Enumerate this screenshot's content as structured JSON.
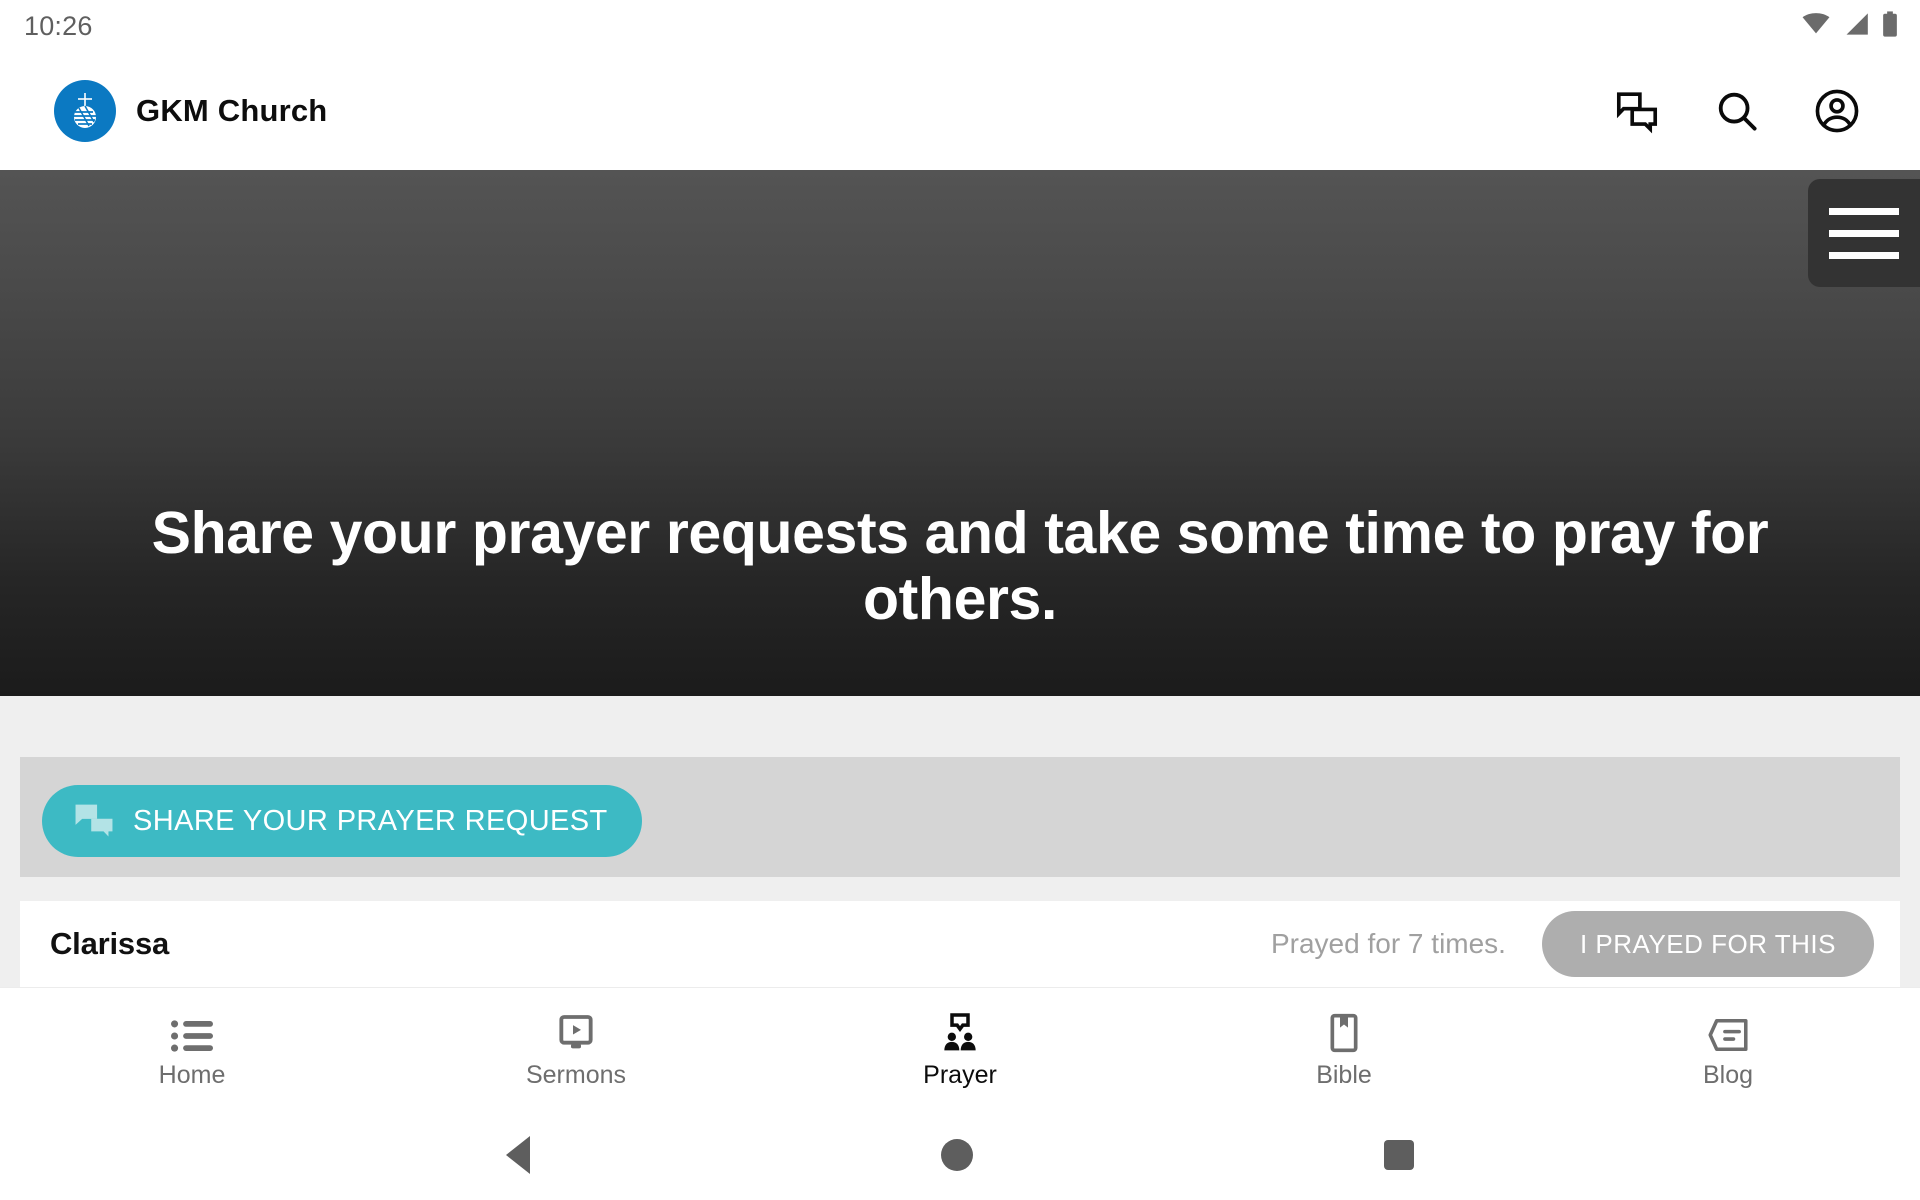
{
  "status_bar": {
    "clock": "10:26",
    "icons": [
      "wifi-icon",
      "cellular-signal-icon",
      "battery-icon"
    ]
  },
  "app_bar": {
    "brand_title": "GKM Church",
    "logo_icon": "gkm-globe-cross-logo",
    "logo_color": "#0b79c2",
    "actions": [
      {
        "name": "chat-icon",
        "label": "Chat"
      },
      {
        "name": "search-icon",
        "label": "Search"
      },
      {
        "name": "account-circle-icon",
        "label": "Account"
      }
    ]
  },
  "hero": {
    "title": "Share your prayer requests and take some time to pray for others.",
    "menu_icon": "hamburger-menu-icon",
    "gradient_top": "#545454",
    "gradient_bottom": "#1b1b1b"
  },
  "share_section": {
    "button_label": "SHARE YOUR PRAYER REQUEST",
    "button_icon": "chat-bubbles-icon",
    "button_color": "#3dbac4",
    "panel_color": "#d5d5d5"
  },
  "prayer_list": [
    {
      "name": "Clarissa",
      "count_text": "Prayed for 7 times.",
      "action_label": "I PRAYED FOR THIS",
      "action_color": "#aeaeae"
    }
  ],
  "bottom_nav": {
    "active": "Prayer",
    "items": [
      {
        "label": "Home",
        "icon": "list-icon",
        "active": false
      },
      {
        "label": "Sermons",
        "icon": "video-screen-icon",
        "active": false
      },
      {
        "label": "Prayer",
        "icon": "people-prayer-icon",
        "active": true
      },
      {
        "label": "Bible",
        "icon": "book-bookmark-icon",
        "active": false
      },
      {
        "label": "Blog",
        "icon": "message-note-icon",
        "active": false
      }
    ]
  },
  "system_nav": {
    "back": "back-button",
    "home": "home-button",
    "recents": "recents-button"
  }
}
